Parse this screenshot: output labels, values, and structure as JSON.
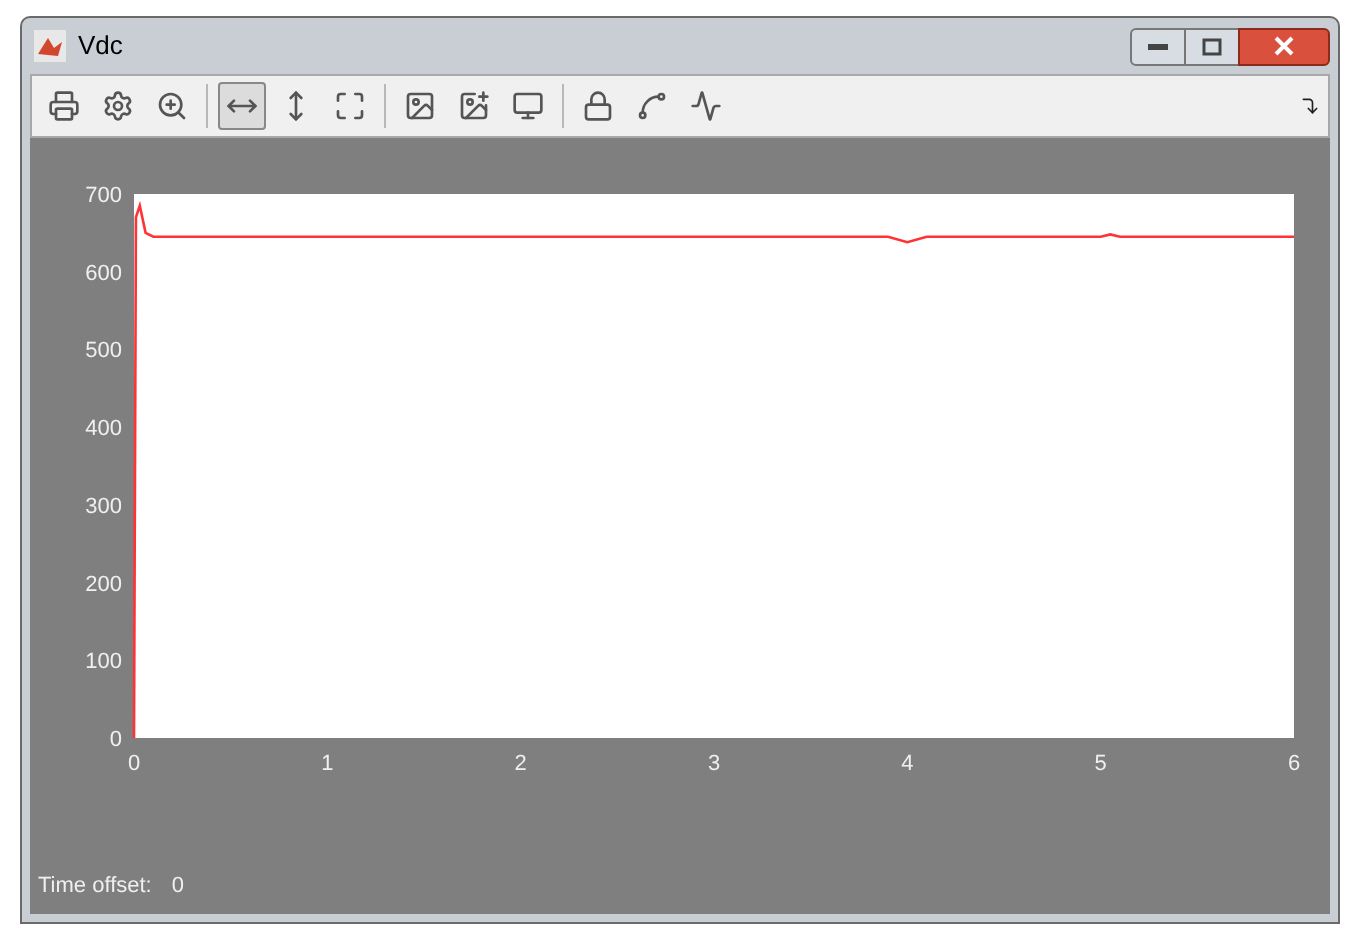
{
  "window": {
    "title": "Vdc"
  },
  "toolbar": {
    "buttons": [
      {
        "selected": false
      },
      {
        "selected": false
      },
      {
        "selected": false
      },
      {
        "selected": true
      },
      {
        "selected": false
      },
      {
        "selected": false
      },
      {
        "selected": false
      },
      {
        "selected": false
      },
      {
        "selected": false
      },
      {
        "selected": false
      },
      {
        "selected": false
      },
      {
        "selected": false
      }
    ]
  },
  "plot": {
    "chart_data": {
      "type": "line",
      "x": [
        0,
        0.01,
        0.03,
        0.06,
        0.1,
        1,
        2,
        3,
        3.9,
        4,
        4.1,
        5,
        5.05,
        5.1,
        6
      ],
      "series": [
        {
          "color": "#ff3333",
          "values": [
            0,
            670,
            685,
            650,
            645,
            645,
            645,
            645,
            645,
            638,
            645,
            645,
            648,
            645,
            645
          ]
        }
      ],
      "xlim": [
        0,
        6
      ],
      "ylim": [
        0,
        700
      ],
      "xticks": [
        0,
        1,
        2,
        3,
        4,
        5,
        6
      ],
      "yticks": [
        0,
        100,
        200,
        300,
        400,
        500,
        600,
        700
      ]
    }
  },
  "status": {
    "label": "Time offset:",
    "value": "0"
  }
}
